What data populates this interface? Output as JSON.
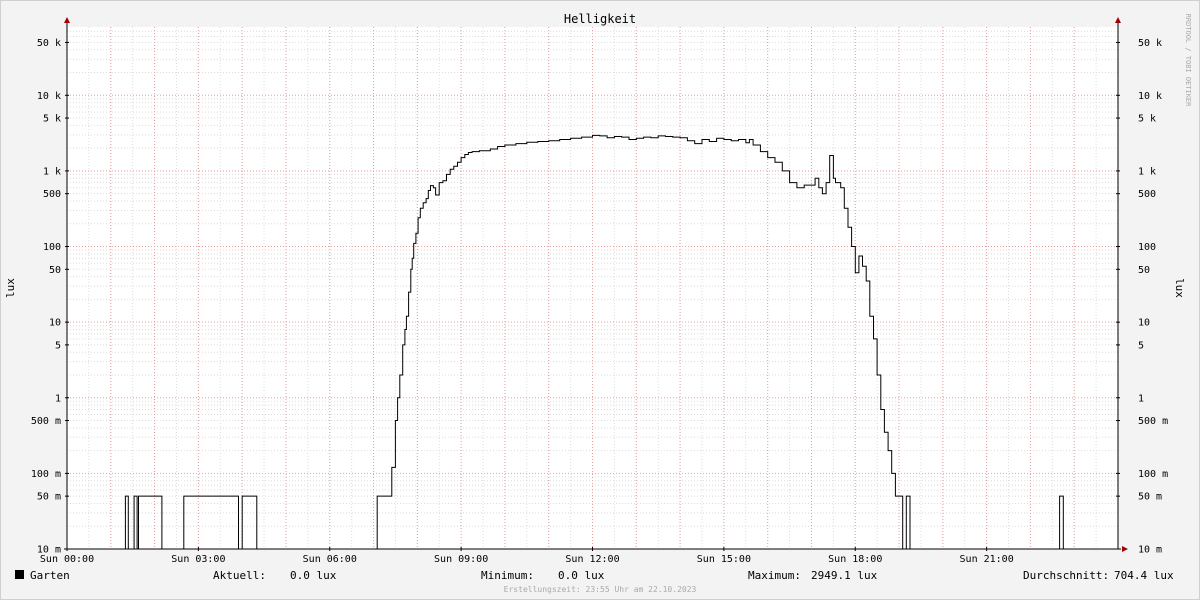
{
  "chart_data": {
    "type": "line",
    "title": "Helligkeit",
    "ylabel": "lux",
    "xlabel": "",
    "y_scale": "log",
    "ylim": [
      0.01,
      80000
    ],
    "xlim": [
      "00:00",
      "24:00"
    ],
    "grid": true,
    "x_ticks": [
      {
        "x": "00:00",
        "label": "Sun 00:00"
      },
      {
        "x": "03:00",
        "label": "Sun 03:00"
      },
      {
        "x": "06:00",
        "label": "Sun 06:00"
      },
      {
        "x": "09:00",
        "label": "Sun 09:00"
      },
      {
        "x": "12:00",
        "label": "Sun 12:00"
      },
      {
        "x": "15:00",
        "label": "Sun 15:00"
      },
      {
        "x": "18:00",
        "label": "Sun 18:00"
      },
      {
        "x": "21:00",
        "label": "Sun 21:00"
      }
    ],
    "y_ticks": [
      {
        "y": 0.01,
        "label": "10 m"
      },
      {
        "y": 0.05,
        "label": "50 m"
      },
      {
        "y": 0.1,
        "label": "100 m"
      },
      {
        "y": 0.5,
        "label": "500 m"
      },
      {
        "y": 1,
        "label": "1"
      },
      {
        "y": 5,
        "label": "5"
      },
      {
        "y": 10,
        "label": "10"
      },
      {
        "y": 50,
        "label": "50"
      },
      {
        "y": 100,
        "label": "100"
      },
      {
        "y": 500,
        "label": "500"
      },
      {
        "y": 1000,
        "label": "1 k"
      },
      {
        "y": 5000,
        "label": "5 k"
      },
      {
        "y": 10000,
        "label": "10 k"
      },
      {
        "y": 50000,
        "label": "50 k"
      }
    ],
    "series": [
      {
        "name": "Garten",
        "color": "#000000",
        "x": [
          "00:00",
          "01:20",
          "01:24",
          "01:32",
          "01:36",
          "01:38",
          "01:44",
          "02:10",
          "02:35",
          "02:40",
          "03:28",
          "03:55",
          "04:00",
          "04:20",
          "07:05",
          "07:10",
          "07:25",
          "07:30",
          "07:33",
          "07:36",
          "07:40",
          "07:43",
          "07:45",
          "07:48",
          "07:51",
          "07:53",
          "07:55",
          "07:58",
          "08:01",
          "08:04",
          "08:08",
          "08:12",
          "08:15",
          "08:18",
          "08:22",
          "08:25",
          "08:30",
          "08:35",
          "08:40",
          "08:45",
          "08:50",
          "08:55",
          "09:00",
          "09:05",
          "09:10",
          "09:15",
          "09:25",
          "09:30",
          "09:40",
          "09:50",
          "10:00",
          "10:15",
          "10:30",
          "10:45",
          "11:00",
          "11:15",
          "11:30",
          "11:45",
          "12:00",
          "12:10",
          "12:20",
          "12:30",
          "12:40",
          "12:50",
          "13:00",
          "13:10",
          "13:20",
          "13:30",
          "13:40",
          "13:50",
          "14:00",
          "14:10",
          "14:20",
          "14:30",
          "14:40",
          "14:50",
          "15:00",
          "15:10",
          "15:20",
          "15:30",
          "15:35",
          "15:40",
          "15:50",
          "16:00",
          "16:10",
          "16:20",
          "16:30",
          "16:40",
          "16:50",
          "16:58",
          "17:05",
          "17:10",
          "17:15",
          "17:20",
          "17:25",
          "17:30",
          "17:33",
          "17:40",
          "17:45",
          "17:50",
          "17:55",
          "18:00",
          "18:05",
          "18:10",
          "18:15",
          "18:20",
          "18:25",
          "18:30",
          "18:35",
          "18:40",
          "18:45",
          "18:50",
          "18:55",
          "19:00",
          "19:05",
          "19:10",
          "19:15",
          "19:20",
          "19:25",
          "19:35",
          "19:38",
          "19:40",
          "19:45",
          "19:50",
          "22:40",
          "22:45",
          "22:55",
          "24:00"
        ],
        "y": [
          0.01,
          0.05,
          0.01,
          0.05,
          0.01,
          0.05,
          0.05,
          0.01,
          0.01,
          0.05,
          0.05,
          0.01,
          0.05,
          0.01,
          0.05,
          0.05,
          0.12,
          0.5,
          1.0,
          2.0,
          5.0,
          8.0,
          12.0,
          25.0,
          50.0,
          70.0,
          110.0,
          150.0,
          240.0,
          320.0,
          380.0,
          430.0,
          550.0,
          640.0,
          600.0,
          480.0,
          700.0,
          740.0,
          900.0,
          1050.0,
          1150.0,
          1300.0,
          1500.0,
          1650.0,
          1750.0,
          1800.0,
          1850.0,
          1850.0,
          1950.0,
          2100.0,
          2200.0,
          2300.0,
          2400.0,
          2450.0,
          2500.0,
          2600.0,
          2700.0,
          2800.0,
          2949.1,
          2900.0,
          2750.0,
          2850.0,
          2800.0,
          2600.0,
          2700.0,
          2800.0,
          2750.0,
          2900.0,
          2850.0,
          2800.0,
          2750.0,
          2500.0,
          2300.0,
          2600.0,
          2450.0,
          2700.0,
          2600.0,
          2500.0,
          2600.0,
          2350.0,
          2600.0,
          2200.0,
          1800.0,
          1500.0,
          1300.0,
          1000.0,
          700.0,
          600.0,
          650.0,
          650.0,
          800.0,
          600.0,
          500.0,
          700.0,
          1600.0,
          800.0,
          700.0,
          600.0,
          320.0,
          180.0,
          100.0,
          45.0,
          75.0,
          55.0,
          35.0,
          12.0,
          6.0,
          2.0,
          0.7,
          0.35,
          0.2,
          0.1,
          0.05,
          0.05,
          0.01,
          0.05,
          0.01,
          0.01,
          0.01,
          0.01,
          0.01,
          0.01,
          0.01,
          0.01,
          0.05,
          0.01,
          0.01,
          0.01
        ]
      }
    ],
    "legend": {
      "name": "Garten",
      "stats": [
        {
          "label": "Aktuell:",
          "value": "0.0 lux"
        },
        {
          "label": "Minimum:",
          "value": "0.0 lux"
        },
        {
          "label": "Maximum:",
          "value": "2949.1 lux"
        },
        {
          "label": "Durchschnitt:",
          "value": "704.4 lux"
        }
      ]
    },
    "timestamp": "Erstellungszeit: 23:55 Uhr am 22.10.2023",
    "watermark": "RRDTOOL / TOBI OETIKER",
    "colors": {
      "background": "#f3f3f3",
      "plot_background": "#ffffff",
      "major_grid": "#e8a0a0",
      "minor_grid": "#dcdcdc",
      "arrow": "#a00000",
      "line": "#000000"
    }
  }
}
